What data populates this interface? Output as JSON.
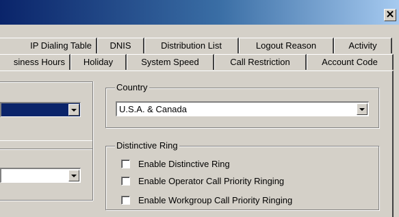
{
  "titlebar": {
    "close_label": "✕"
  },
  "tabs_row1": [
    "IP Dialing Table",
    "DNIS",
    "Distribution List",
    "Logout Reason",
    "Activity"
  ],
  "tabs_row2": [
    "siness Hours",
    "Holiday",
    "System Speed",
    "Call Restriction",
    "Account Code"
  ],
  "country": {
    "legend": "Country",
    "value": "U.S.A. & Canada"
  },
  "distinctive_ring": {
    "legend": "Distinctive Ring",
    "options": [
      {
        "label": "Enable Distinctive Ring",
        "checked": false
      },
      {
        "label": "Enable Operator Call Priority Ringing",
        "checked": false
      },
      {
        "label": "Enable Workgroup Call Priority Ringing",
        "checked": false
      }
    ]
  }
}
